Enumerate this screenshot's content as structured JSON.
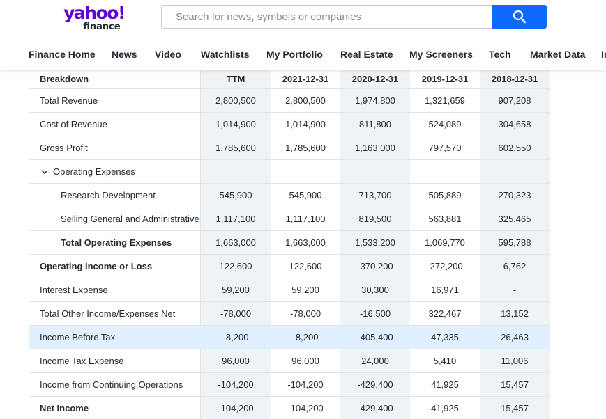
{
  "brand": {
    "logo_main": "yahoo!",
    "logo_sub": "finance"
  },
  "search": {
    "placeholder": "Search for news, symbols or companies",
    "value": ""
  },
  "nav": [
    {
      "label": "Finance Home"
    },
    {
      "label": "News"
    },
    {
      "label": "Video"
    },
    {
      "label": "Watchlists"
    },
    {
      "label": "My Portfolio"
    },
    {
      "label": "Real Estate"
    },
    {
      "label": "My Screeners"
    },
    {
      "label": "Tech"
    },
    {
      "label": "Market Data"
    },
    {
      "label": "In"
    }
  ],
  "table": {
    "headers": [
      "Breakdown",
      "TTM",
      "2021-12-31",
      "2020-12-31",
      "2019-12-31",
      "2018-12-31"
    ],
    "rows": [
      {
        "label": "Total Revenue",
        "values": [
          "2,800,500",
          "2,800,500",
          "1,974,800",
          "1,321,659",
          "907,208"
        ]
      },
      {
        "label": "Cost of Revenue",
        "values": [
          "1,014,900",
          "1,014,900",
          "811,800",
          "524,089",
          "304,658"
        ]
      },
      {
        "label": "Gross Profit",
        "values": [
          "1,785,600",
          "1,785,600",
          "1,163,000",
          "797,570",
          "602,550"
        ]
      },
      {
        "label": "Operating Expenses",
        "values": [
          "",
          "",
          "",
          "",
          ""
        ]
      },
      {
        "label": "Research Development",
        "values": [
          "545,900",
          "545,900",
          "713,700",
          "505,889",
          "270,323"
        ]
      },
      {
        "label": "Selling General and Administrative",
        "values": [
          "1,117,100",
          "1,117,100",
          "819,500",
          "563,881",
          "325,465"
        ]
      },
      {
        "label": "Total Operating Expenses",
        "values": [
          "1,663,000",
          "1,663,000",
          "1,533,200",
          "1,069,770",
          "595,788"
        ]
      },
      {
        "label": "Operating Income or Loss",
        "values": [
          "122,600",
          "122,600",
          "-370,200",
          "-272,200",
          "6,762"
        ]
      },
      {
        "label": "Interest Expense",
        "values": [
          "59,200",
          "59,200",
          "30,300",
          "16,971",
          "-"
        ]
      },
      {
        "label": "Total Other Income/Expenses Net",
        "values": [
          "-78,000",
          "-78,000",
          "-16,500",
          "322,467",
          "13,152"
        ]
      },
      {
        "label": "Income Before Tax",
        "values": [
          "-8,200",
          "-8,200",
          "-405,400",
          "47,335",
          "26,463"
        ]
      },
      {
        "label": "Income Tax Expense",
        "values": [
          "96,000",
          "96,000",
          "24,000",
          "5,410",
          "11,006"
        ]
      },
      {
        "label": "Income from Continuing Operations",
        "values": [
          "-104,200",
          "-104,200",
          "-429,400",
          "41,925",
          "15,457"
        ]
      },
      {
        "label": "Net Income",
        "values": [
          "-104,200",
          "-104,200",
          "-429,400",
          "41,925",
          "15,457"
        ]
      }
    ]
  },
  "colors": {
    "brand": "#6001d2",
    "search_button": "#0f69ff",
    "highlight_row": "#e0f0ff",
    "shaded_col": "#f0f3f5"
  }
}
